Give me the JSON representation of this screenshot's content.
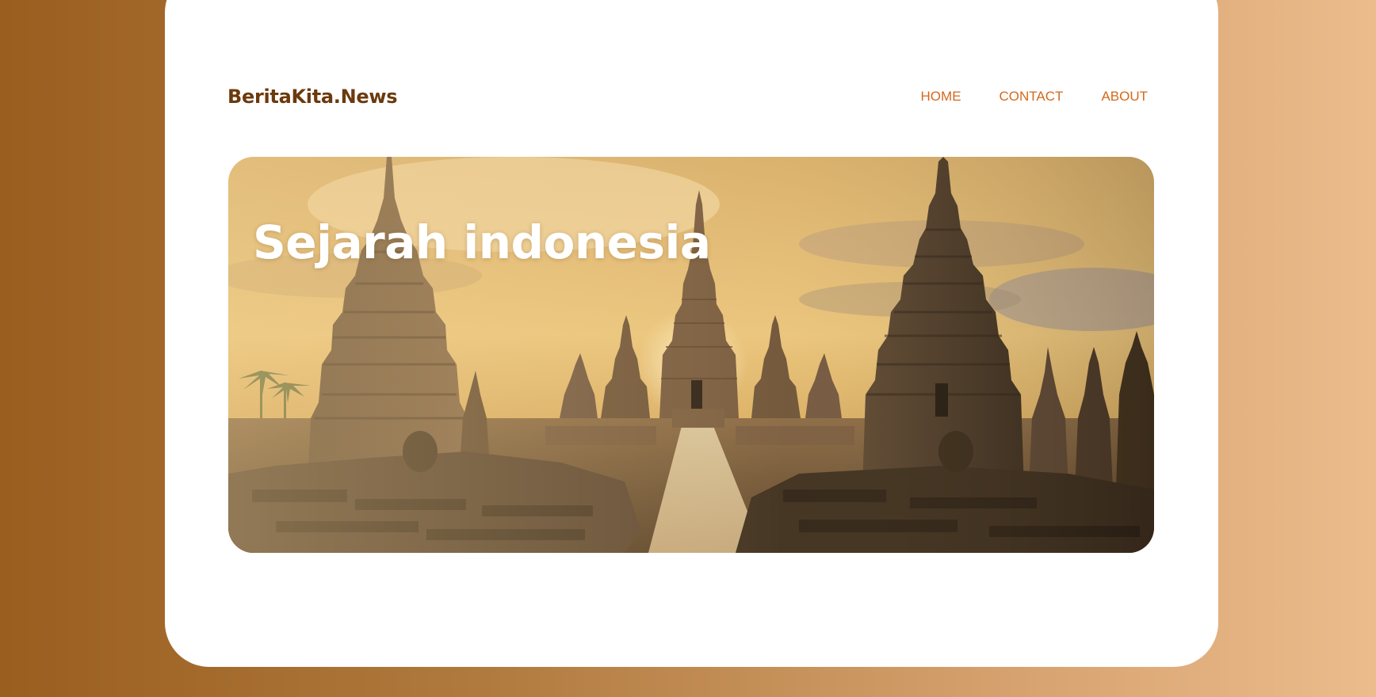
{
  "site": {
    "brand": "BeritaKita.News"
  },
  "nav": {
    "items": [
      {
        "label": "HOME"
      },
      {
        "label": "CONTACT"
      },
      {
        "label": "ABOUT"
      }
    ]
  },
  "hero": {
    "title": "Sejarah indonesia",
    "image_subject": "temple-ruins-at-sunset"
  },
  "colors": {
    "background_start": "#9a5e1f",
    "background_end": "#ecbc8c",
    "card": "#ffffff",
    "brand": "#6b3a0d",
    "nav_link": "#d4691b",
    "hero_title": "#ffffff"
  }
}
